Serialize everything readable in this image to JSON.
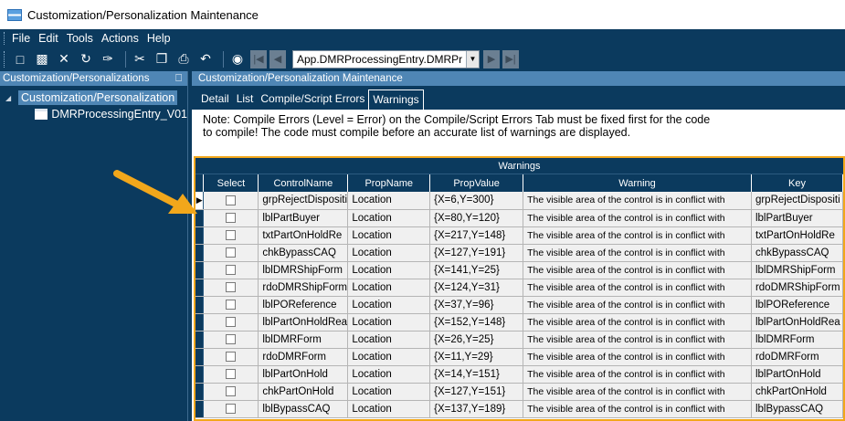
{
  "window": {
    "title": "Customization/Personalization Maintenance"
  },
  "menu": [
    "File",
    "Edit",
    "Tools",
    "Actions",
    "Help"
  ],
  "toolbar": {
    "icons_group1": [
      "new-icon",
      "save-icon",
      "delete-icon",
      "refresh-icon",
      "clear-icon"
    ],
    "icons_group2": [
      "cut-icon",
      "copy-icon",
      "paste-icon",
      "undo-icon"
    ],
    "form_combo_value": "App.DMRProcessingEntry.DMRPr"
  },
  "left_pane": {
    "header": "Customization/Personalizations",
    "pin_icon": "pin-icon",
    "tree_root": "Customization/Personalization",
    "tree_child": "DMRProcessingEntry_V01"
  },
  "right_pane": {
    "header": "Customization/Personalization Maintenance",
    "tabs": [
      {
        "label": "Detail",
        "active": false
      },
      {
        "label": "List",
        "active": false
      },
      {
        "label": "Compile/Script Errors",
        "active": false
      },
      {
        "label": "Warnings",
        "active": true
      }
    ],
    "note_line1": "Note: Compile Errors (Level = Error) on the Compile/Script Errors Tab  must be fixed first for the code",
    "note_line2": "to compile!  The code must compile before an accurate list of warnings are displayed."
  },
  "grid": {
    "title": "Warnings",
    "columns": [
      "Select",
      "ControlName",
      "PropName",
      "PropValue",
      "Warning",
      "Key"
    ],
    "rows": [
      {
        "control": "grpRejectDispositi",
        "prop": "Location",
        "value": "{X=6,Y=300}",
        "warning": "The visible area of the control is in conflict with",
        "key": "grpRejectDispositi"
      },
      {
        "control": "lblPartBuyer",
        "prop": "Location",
        "value": "{X=80,Y=120}",
        "warning": "The visible area of the control is in conflict with",
        "key": "lblPartBuyer"
      },
      {
        "control": "txtPartOnHoldRe",
        "prop": "Location",
        "value": "{X=217,Y=148}",
        "warning": "The visible area of the control is in conflict with",
        "key": "txtPartOnHoldRe"
      },
      {
        "control": "chkBypassCAQ",
        "prop": "Location",
        "value": "{X=127,Y=191}",
        "warning": "The visible area of the control is in conflict with",
        "key": "chkBypassCAQ"
      },
      {
        "control": "lblDMRShipForm",
        "prop": "Location",
        "value": "{X=141,Y=25}",
        "warning": "The visible area of the control is in conflict with",
        "key": "lblDMRShipForm"
      },
      {
        "control": "rdoDMRShipForm",
        "prop": "Location",
        "value": "{X=124,Y=31}",
        "warning": "The visible area of the control is in conflict with",
        "key": "rdoDMRShipForm"
      },
      {
        "control": "lblPOReference",
        "prop": "Location",
        "value": "{X=37,Y=96}",
        "warning": "The visible area of the control is in conflict with",
        "key": "lblPOReference"
      },
      {
        "control": "lblPartOnHoldRea",
        "prop": "Location",
        "value": "{X=152,Y=148}",
        "warning": "The visible area of the control is in conflict with",
        "key": "lblPartOnHoldRea"
      },
      {
        "control": "lblDMRForm",
        "prop": "Location",
        "value": "{X=26,Y=25}",
        "warning": "The visible area of the control is in conflict with",
        "key": "lblDMRForm"
      },
      {
        "control": "rdoDMRForm",
        "prop": "Location",
        "value": "{X=11,Y=29}",
        "warning": "The visible area of the control is in conflict with",
        "key": "rdoDMRForm"
      },
      {
        "control": "lblPartOnHold",
        "prop": "Location",
        "value": "{X=14,Y=151}",
        "warning": "The visible area of the control is in conflict with",
        "key": "lblPartOnHold"
      },
      {
        "control": "chkPartOnHold",
        "prop": "Location",
        "value": "{X=127,Y=151}",
        "warning": "The visible area of the control is in conflict with",
        "key": "chkPartOnHold"
      },
      {
        "control": "lblBypassCAQ",
        "prop": "Location",
        "value": "{X=137,Y=189}",
        "warning": "The visible area of the control is in conflict with",
        "key": "lblBypassCAQ"
      }
    ]
  },
  "colors": {
    "accent": "#0b3a5e",
    "header": "#4f86b5",
    "highlight": "#f2a71b"
  }
}
